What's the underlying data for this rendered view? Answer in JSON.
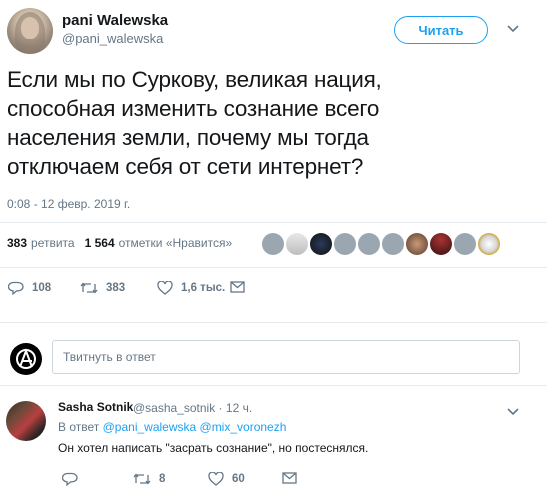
{
  "author": {
    "name": "pani Walewska",
    "handle": "@pani_walewska",
    "follow_label": "Читать"
  },
  "tweet": {
    "text_lines": [
      "Если мы по Суркову,  великая нация,",
      "способная изменить сознание всего",
      "населения земли, почему мы тогда",
      "отключаем себя от сети интернет?"
    ],
    "timestamp": "0:08 - 12 февр. 2019 г."
  },
  "stats": {
    "retweets_count": "383",
    "retweets_label": "ретвита",
    "likes_count": "1 564",
    "likes_label": "отметки «Нравится»"
  },
  "actions": {
    "replies": "108",
    "retweets": "383",
    "likes": "1,6 тыс."
  },
  "reply_box": {
    "placeholder": "Твитнуть в ответ"
  },
  "reply_tweet": {
    "name": "Sasha Sotnik",
    "meta": "@sasha_sotnik · 12 ч.",
    "in_reply_prefix": "В ответ",
    "in_reply_users": "@pani_walewska @mix_voronezh",
    "text": "Он хотел написать \"засрать сознание\", но постеснялся.",
    "retweets": "8",
    "likes": "60"
  },
  "colors": {
    "accent": "#1da1f2",
    "muted": "#657786",
    "text": "#14171a",
    "border": "#e6ecf0"
  }
}
